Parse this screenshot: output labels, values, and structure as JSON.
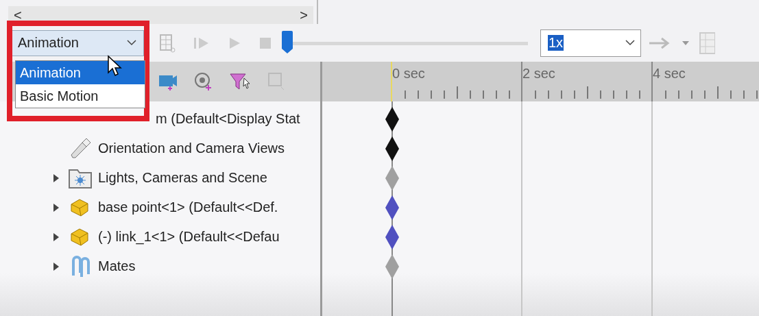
{
  "scroll_bar": {
    "left_arrow": "<",
    "right_arrow": ">"
  },
  "study_type": {
    "value": "Animation",
    "expanded": true,
    "options": [
      {
        "label": "Animation",
        "selected": true
      },
      {
        "label": "Basic Motion",
        "selected": false
      }
    ]
  },
  "time_slider": {
    "level": 0
  },
  "playback_speed": {
    "value": "1x"
  },
  "timeline": {
    "labels": [
      "0 sec",
      "2 sec",
      "4 sec"
    ]
  },
  "tree": [
    {
      "label": "m  (Default<Display Stat",
      "color": "#111111"
    },
    {
      "label": "Orientation and Camera Views",
      "kind": "camera",
      "color": "#111111"
    },
    {
      "label": "Lights, Cameras and Scene",
      "kind": "folder",
      "expanded": false,
      "color": "#a0a0a0"
    },
    {
      "label": "base point<1> (Default<<Def.",
      "kind": "part",
      "expanded": false,
      "color": "#5050c0"
    },
    {
      "label": "(-) link_1<1> (Default<<Defau",
      "kind": "part",
      "expanded": false,
      "color": "#5050c0"
    },
    {
      "label": "Mates",
      "kind": "mates",
      "expanded": false,
      "color": "#a0a0a0"
    }
  ]
}
